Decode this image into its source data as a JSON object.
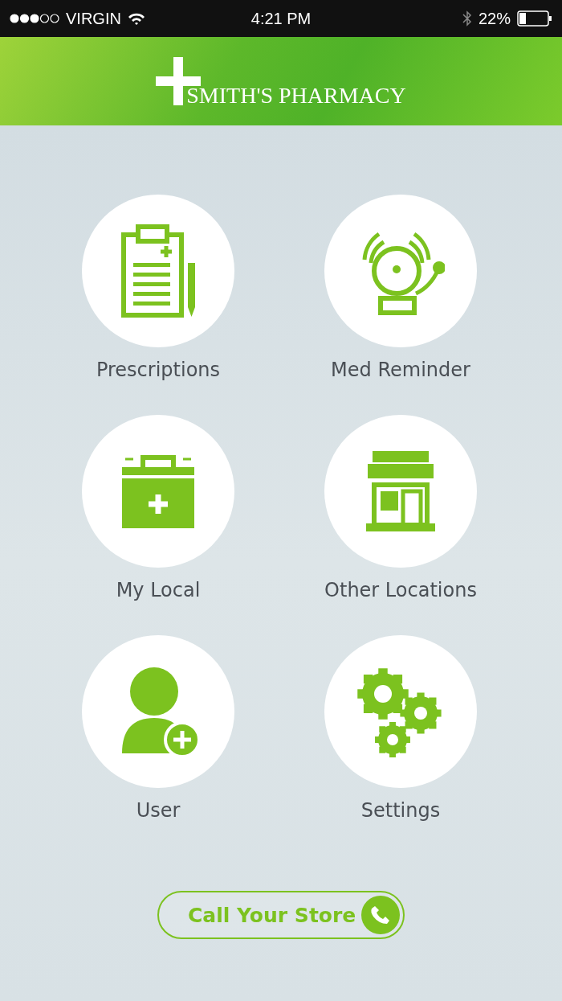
{
  "status_bar": {
    "carrier": "VIRGIN",
    "time": "4:21 PM",
    "battery": "22%"
  },
  "header": {
    "title": "SMITH'S PHARMACY"
  },
  "tiles": [
    {
      "label": "Prescriptions",
      "kind": "clipboard"
    },
    {
      "label": "Med Reminder",
      "kind": "bell"
    },
    {
      "label": "My Local",
      "kind": "kit"
    },
    {
      "label": "Other Locations",
      "kind": "store"
    },
    {
      "label": "User",
      "kind": "user"
    },
    {
      "label": "Settings",
      "kind": "gears"
    }
  ],
  "call_button": {
    "label": "Call Your Store"
  }
}
